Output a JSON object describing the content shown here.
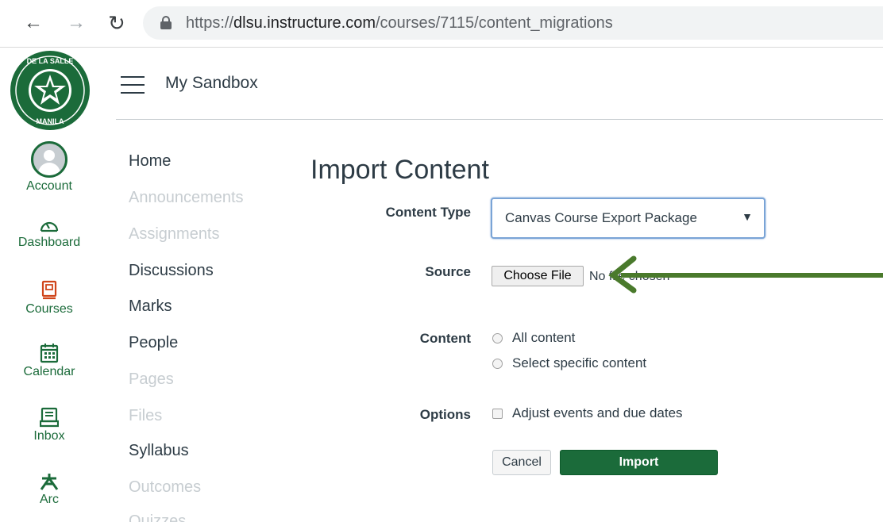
{
  "browser": {
    "back_icon": "arrow-left-icon",
    "forward_icon": "arrow-right-icon",
    "reload_icon": "reload-icon",
    "url_scheme": "https://",
    "url_host": "dlsu.instructure.com",
    "url_path": "/courses/7115/content_migrations"
  },
  "global_nav": {
    "items": [
      {
        "label": "Account",
        "icon": "avatar-icon"
      },
      {
        "label": "Dashboard",
        "icon": "speedometer-icon"
      },
      {
        "label": "Courses",
        "icon": "book-icon"
      },
      {
        "label": "Calendar",
        "icon": "calendar-icon"
      },
      {
        "label": "Inbox",
        "icon": "inbox-icon"
      },
      {
        "label": "Arc",
        "icon": "arc-icon"
      }
    ],
    "brand_color": "#1b6b3a",
    "courses_color": "#d0451b"
  },
  "header": {
    "crumb": "My Sandbox"
  },
  "course_nav": {
    "items": [
      {
        "label": "Home",
        "active": true
      },
      {
        "label": "Announcements",
        "active": false
      },
      {
        "label": "Assignments",
        "active": false
      },
      {
        "label": "Discussions",
        "active": true
      },
      {
        "label": "Marks",
        "active": true
      },
      {
        "label": "People",
        "active": true
      },
      {
        "label": "Pages",
        "active": false
      },
      {
        "label": "Files",
        "active": false
      },
      {
        "label": "Syllabus",
        "active": true
      },
      {
        "label": "Outcomes",
        "active": false
      },
      {
        "label": "Quizzes",
        "active": false
      }
    ]
  },
  "main": {
    "title": "Import Content",
    "content_type_label": "Content Type",
    "content_type_value": "Canvas Course Export Package",
    "source_label": "Source",
    "choose_file": "Choose File",
    "no_file": "No file chosen",
    "content_label": "Content",
    "content_options": [
      "All content",
      "Select specific content"
    ],
    "options_label": "Options",
    "adjust_dates": "Adjust events and due dates",
    "cancel": "Cancel",
    "import": "Import"
  },
  "annotation": {
    "arrow_color": "#4a7a2c"
  }
}
